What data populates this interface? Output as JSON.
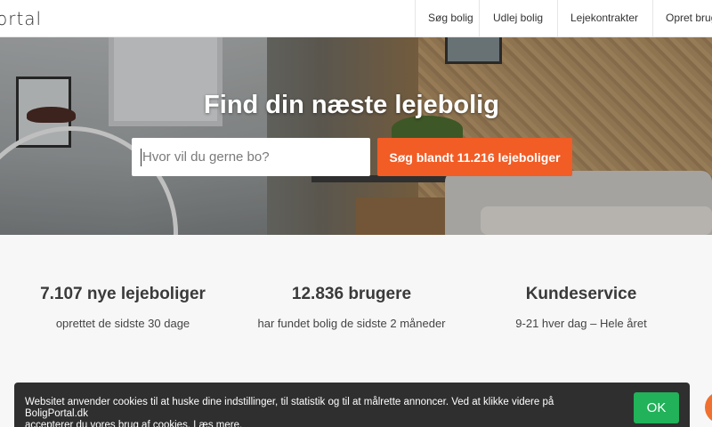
{
  "header": {
    "logo_text": "ortal",
    "nav": [
      "Søg bolig",
      "Udlej bolig",
      "Lejekontrakter",
      "Opret brug"
    ]
  },
  "hero": {
    "title": "Find din næste lejebolig",
    "search_placeholder": "Hvor vil du gerne bo?",
    "search_button": "Søg blandt 11.216 lejeboliger"
  },
  "stats": [
    {
      "value": "7.107 nye lejeboliger",
      "desc": "oprettet de sidste 30 dage"
    },
    {
      "value": "12.836 brugere",
      "desc": "har fundet bolig de sidste 2 måneder"
    },
    {
      "value": "Kundeservice",
      "desc": "9-21 hver dag – Hele året"
    }
  ],
  "cookie": {
    "text_line1": "Websitet anvender cookies til at huske dine indstillinger, til statistik og til at målrette annoncer. Ved at klikke videre på BoligPortal.dk",
    "text_line2": "accepterer du vores brug af cookies.",
    "link": "Læs mere.",
    "ok": "OK"
  },
  "colors": {
    "accent": "#f25c25",
    "ok_green": "#21b25a",
    "cookie_bg": "#2f2f2f"
  }
}
